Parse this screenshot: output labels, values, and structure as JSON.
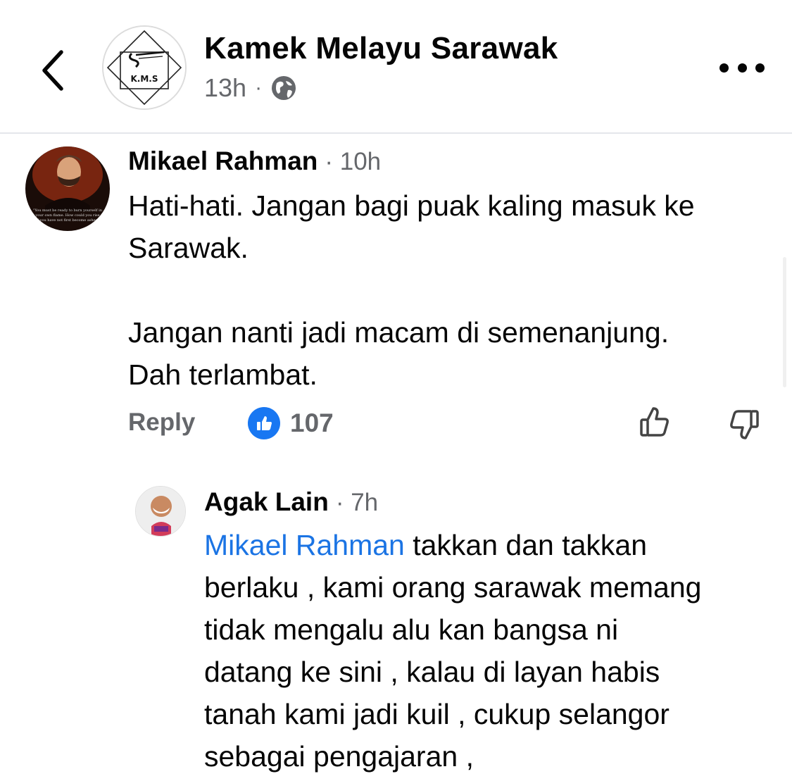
{
  "header": {
    "page_name": "Kamek Melayu Sarawak",
    "time": "13h",
    "separator": "·",
    "logo_text": "K.M.S",
    "back_icon": "chevron-left-icon",
    "privacy_icon": "globe-icon",
    "more_icon": "more-dots-icon"
  },
  "comments": [
    {
      "author": "Mikael Rahman",
      "time": "· 10h",
      "body": [
        "Hati-hati. Jangan bagi puak kaling masuk ke",
        "Sarawak.",
        "",
        "Jangan nanti jadi macam di semenanjung.",
        "Dah terlambat."
      ],
      "reply_label": "Reply",
      "reaction_count": "107",
      "avatar_text": "\"You must be ready to burn yourself in your own flame. How could you rise if you have not first become ashes\""
    },
    {
      "author": "Agak Lain",
      "time": "· 7h",
      "mention": "Mikael Rahman",
      "body_first": " takkan dan takkan",
      "body": [
        "berlaku , kami orang sarawak memang",
        "tidak mengalu alu kan bangsa ni",
        "datang ke sini , kalau di layan habis",
        "tanah kami jadi kuil , cukup selangor",
        "sebagai pengajaran ,"
      ]
    }
  ],
  "colors": {
    "accent": "#1877f2",
    "mention": "#1b74e4",
    "secondary_text": "#65676b",
    "divider": "#e4e6eb"
  }
}
